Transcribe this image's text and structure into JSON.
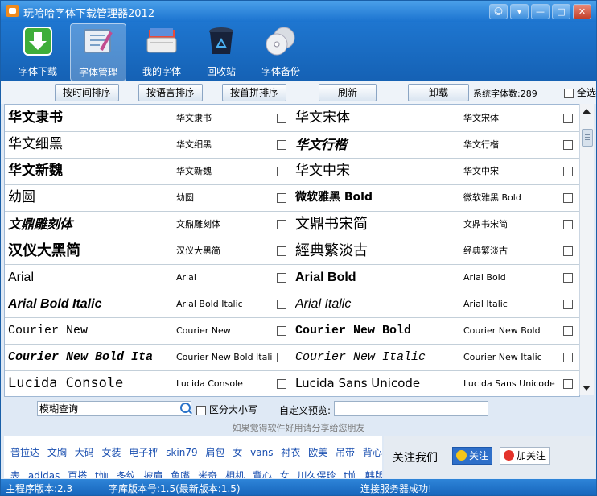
{
  "window": {
    "title": "玩哈哈字体下载管理器2012",
    "controls": [
      "☺",
      "▾",
      "—",
      "□",
      "✕"
    ]
  },
  "toolbar": {
    "items": [
      {
        "label": "字体下载",
        "icon": "download-icon"
      },
      {
        "label": "字体管理",
        "icon": "font-manage-icon",
        "active": true
      },
      {
        "label": "我的字体",
        "icon": "my-fonts-icon"
      },
      {
        "label": "回收站",
        "icon": "recycle-bin-icon"
      },
      {
        "label": "字体备份",
        "icon": "backup-disc-icon"
      }
    ]
  },
  "sortbar": {
    "sort_time": "按时间排序",
    "sort_lang": "按语言排序",
    "sort_pinyin": "按首拼排序",
    "refresh": "刷新",
    "uninstall": "卸载",
    "system_count": "系统字体数:289",
    "select_all": "全选"
  },
  "fonts": [
    {
      "left_sample": "华文隶书",
      "left_name": "华文隶书",
      "right_sample": "华文宋体",
      "right_name": "华文宋体"
    },
    {
      "left_sample": "华文细黑",
      "left_name": "华文细黑",
      "right_sample": "华文行楷",
      "right_name": "华文行楷"
    },
    {
      "left_sample": "华文新魏",
      "left_name": "华文新魏",
      "right_sample": "华文中宋",
      "right_name": "华文中宋"
    },
    {
      "left_sample": "幼圆",
      "left_name": "幼圆",
      "right_sample": "微软雅黑 Bold",
      "right_name": "微软雅黑 Bold"
    },
    {
      "left_sample": "文鼎雕刻体",
      "left_name": "文鼎雕刻体",
      "right_sample": "文鼎书宋简",
      "right_name": "文鼎书宋简"
    },
    {
      "left_sample": "汉仪大黑简",
      "left_name": "汉仪大黑简",
      "right_sample": "經典繁淡古",
      "right_name": "经典繁淡古"
    },
    {
      "left_sample": "Arial",
      "left_name": "Arial",
      "right_sample": "Arial Bold",
      "right_name": "Arial Bold"
    },
    {
      "left_sample": "Arial Bold Italic",
      "left_name": "Arial Bold Italic",
      "right_sample": "Arial Italic",
      "right_name": "Arial Italic"
    },
    {
      "left_sample": "Courier New",
      "left_name": "Courier New",
      "right_sample": "Courier New Bold",
      "right_name": "Courier New Bold"
    },
    {
      "left_sample": "Courier New Bold Ita",
      "left_name": "Courier New Bold Italic",
      "right_sample": "Courier New Italic",
      "right_name": "Courier New Italic"
    },
    {
      "left_sample": "Lucida Console",
      "left_name": "Lucida Console",
      "right_sample": "Lucida Sans Unicode",
      "right_name": "Lucida Sans Unicode"
    }
  ],
  "search": {
    "value": "模糊查询",
    "case_label": "区分大小写",
    "preview_label": "自定义预览:",
    "preview_value": ""
  },
  "share_text": "如果觉得软件好用请分享给您朋友",
  "links": {
    "line1": [
      "普拉达",
      "文胸",
      "大码",
      "女装",
      "电子秤",
      "skin79",
      "肩包",
      "女",
      "vans",
      "衬衣",
      "欧美",
      "吊带",
      "背心"
    ],
    "line2": [
      "表",
      "adidas",
      "百搭",
      "t恤",
      "多纹",
      "披肩",
      "鱼嘴",
      "米奇",
      "相机",
      "背心",
      "女",
      "川久保玲",
      "t恤",
      "韩版"
    ]
  },
  "follow": {
    "label": "关注我们",
    "qq_button": "关注",
    "weibo_button": "加关注"
  },
  "status": {
    "main_version": "主程序版本:2.3",
    "lib_version": "字库版本号:1.5(最新版本:1.5)",
    "server": "连接服务器成功!"
  },
  "colors": {
    "title_bar": "#1b73cf",
    "toolbar": "#1e76d0",
    "status_bar": "#1766bc",
    "link": "#1a4fb0"
  }
}
